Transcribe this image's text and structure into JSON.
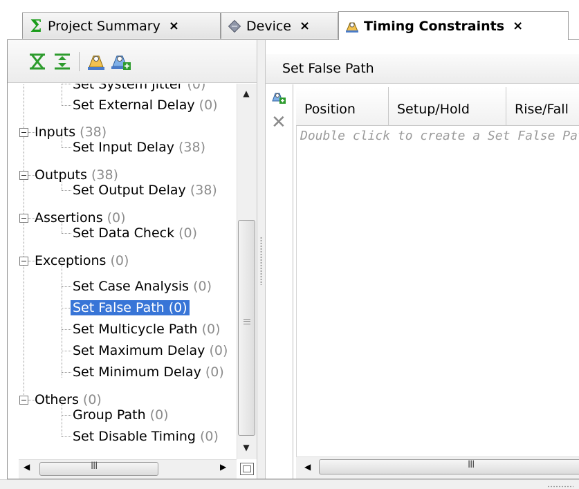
{
  "tabs": [
    {
      "label": "Project Summary",
      "icon": "sigma-icon",
      "close": "×",
      "active": false
    },
    {
      "label": "Device",
      "icon": "chip-icon",
      "close": "×",
      "active": false
    },
    {
      "label": "Timing Constraints",
      "icon": "timing-constraints-icon",
      "close": "×",
      "active": true
    }
  ],
  "left_toolbar": {
    "icons": [
      "expand-all-icon",
      "collapse-all-icon",
      "constraint-icon",
      "add-constraint-icon"
    ]
  },
  "tree": {
    "items": [
      {
        "label": "Set System Jitter",
        "count": "(0)",
        "level": 1
      },
      {
        "label": "Set External Delay",
        "count": "(0)",
        "level": 1
      },
      {
        "label": "Inputs",
        "count": "(38)",
        "level": 0
      },
      {
        "label": "Set Input Delay",
        "count": "(38)",
        "level": 1
      },
      {
        "label": "Outputs",
        "count": "(38)",
        "level": 0
      },
      {
        "label": "Set Output Delay",
        "count": "(38)",
        "level": 1
      },
      {
        "label": "Assertions",
        "count": "(0)",
        "level": 0
      },
      {
        "label": "Set Data Check",
        "count": "(0)",
        "level": 1
      },
      {
        "label": "Exceptions",
        "count": "(0)",
        "level": 0
      },
      {
        "label": "Set Case Analysis",
        "count": "(0)",
        "level": 1
      },
      {
        "label": "Set False Path",
        "count": "(0)",
        "level": 1,
        "selected": true
      },
      {
        "label": "Set Multicycle Path",
        "count": "(0)",
        "level": 1
      },
      {
        "label": "Set Maximum Delay",
        "count": "(0)",
        "level": 1
      },
      {
        "label": "Set Minimum Delay",
        "count": "(0)",
        "level": 1
      },
      {
        "label": "Others",
        "count": "(0)",
        "level": 0
      },
      {
        "label": "Group Path",
        "count": "(0)",
        "level": 1
      },
      {
        "label": "Set Disable Timing",
        "count": "(0)",
        "level": 1
      }
    ]
  },
  "right_panel": {
    "title": "Set False Path",
    "columns": [
      "Position",
      "Setup/Hold",
      "Rise/Fall"
    ],
    "hint": "Double click to create a Set False Path"
  },
  "scroll": {
    "grip": "III"
  },
  "colors": {
    "selection": "#3875d7",
    "count_text": "#8c8c8c",
    "hint_text": "#9a9a9a"
  }
}
